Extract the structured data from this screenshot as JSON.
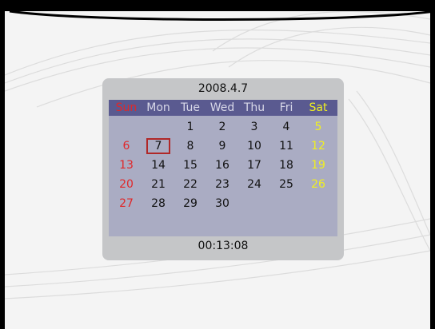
{
  "calendar": {
    "date_title": "2008.4.7",
    "weekdays": [
      "Sun",
      "Mon",
      "Tue",
      "Wed",
      "Thu",
      "Fri",
      "Sat"
    ],
    "days": [
      [
        "",
        "",
        "1",
        "2",
        "3",
        "4",
        "5"
      ],
      [
        "6",
        "7",
        "8",
        "9",
        "10",
        "11",
        "12"
      ],
      [
        "13",
        "14",
        "15",
        "16",
        "17",
        "18",
        "19"
      ],
      [
        "20",
        "21",
        "22",
        "23",
        "24",
        "25",
        "26"
      ],
      [
        "27",
        "28",
        "29",
        "30",
        "",
        "",
        ""
      ]
    ],
    "selected_day": "7",
    "time": "00:13:08"
  },
  "colors": {
    "sunday": "#e0282a",
    "saturday": "#f0f020",
    "weekday_header": "#d8d8e8",
    "header_bg": "#5a5a90",
    "selection_border": "#b02828"
  }
}
